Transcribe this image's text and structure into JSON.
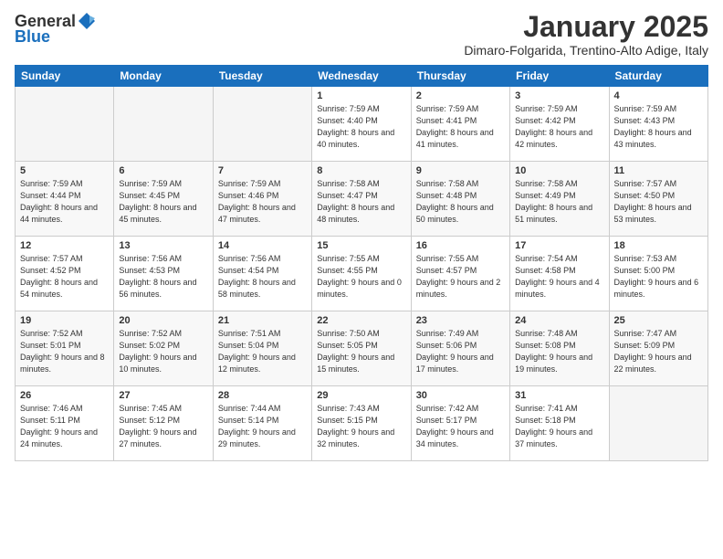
{
  "header": {
    "logo_line1": "General",
    "logo_line2": "Blue",
    "month": "January 2025",
    "location": "Dimaro-Folgarida, Trentino-Alto Adige, Italy"
  },
  "weekdays": [
    "Sunday",
    "Monday",
    "Tuesday",
    "Wednesday",
    "Thursday",
    "Friday",
    "Saturday"
  ],
  "weeks": [
    [
      {
        "day": "",
        "empty": true
      },
      {
        "day": "",
        "empty": true
      },
      {
        "day": "",
        "empty": true
      },
      {
        "day": "1",
        "sunrise": "7:59 AM",
        "sunset": "4:40 PM",
        "daylight": "8 hours and 40 minutes."
      },
      {
        "day": "2",
        "sunrise": "7:59 AM",
        "sunset": "4:41 PM",
        "daylight": "8 hours and 41 minutes."
      },
      {
        "day": "3",
        "sunrise": "7:59 AM",
        "sunset": "4:42 PM",
        "daylight": "8 hours and 42 minutes."
      },
      {
        "day": "4",
        "sunrise": "7:59 AM",
        "sunset": "4:43 PM",
        "daylight": "8 hours and 43 minutes."
      }
    ],
    [
      {
        "day": "5",
        "sunrise": "7:59 AM",
        "sunset": "4:44 PM",
        "daylight": "8 hours and 44 minutes."
      },
      {
        "day": "6",
        "sunrise": "7:59 AM",
        "sunset": "4:45 PM",
        "daylight": "8 hours and 45 minutes."
      },
      {
        "day": "7",
        "sunrise": "7:59 AM",
        "sunset": "4:46 PM",
        "daylight": "8 hours and 47 minutes."
      },
      {
        "day": "8",
        "sunrise": "7:58 AM",
        "sunset": "4:47 PM",
        "daylight": "8 hours and 48 minutes."
      },
      {
        "day": "9",
        "sunrise": "7:58 AM",
        "sunset": "4:48 PM",
        "daylight": "8 hours and 50 minutes."
      },
      {
        "day": "10",
        "sunrise": "7:58 AM",
        "sunset": "4:49 PM",
        "daylight": "8 hours and 51 minutes."
      },
      {
        "day": "11",
        "sunrise": "7:57 AM",
        "sunset": "4:50 PM",
        "daylight": "8 hours and 53 minutes."
      }
    ],
    [
      {
        "day": "12",
        "sunrise": "7:57 AM",
        "sunset": "4:52 PM",
        "daylight": "8 hours and 54 minutes."
      },
      {
        "day": "13",
        "sunrise": "7:56 AM",
        "sunset": "4:53 PM",
        "daylight": "8 hours and 56 minutes."
      },
      {
        "day": "14",
        "sunrise": "7:56 AM",
        "sunset": "4:54 PM",
        "daylight": "8 hours and 58 minutes."
      },
      {
        "day": "15",
        "sunrise": "7:55 AM",
        "sunset": "4:55 PM",
        "daylight": "9 hours and 0 minutes."
      },
      {
        "day": "16",
        "sunrise": "7:55 AM",
        "sunset": "4:57 PM",
        "daylight": "9 hours and 2 minutes."
      },
      {
        "day": "17",
        "sunrise": "7:54 AM",
        "sunset": "4:58 PM",
        "daylight": "9 hours and 4 minutes."
      },
      {
        "day": "18",
        "sunrise": "7:53 AM",
        "sunset": "5:00 PM",
        "daylight": "9 hours and 6 minutes."
      }
    ],
    [
      {
        "day": "19",
        "sunrise": "7:52 AM",
        "sunset": "5:01 PM",
        "daylight": "9 hours and 8 minutes."
      },
      {
        "day": "20",
        "sunrise": "7:52 AM",
        "sunset": "5:02 PM",
        "daylight": "9 hours and 10 minutes."
      },
      {
        "day": "21",
        "sunrise": "7:51 AM",
        "sunset": "5:04 PM",
        "daylight": "9 hours and 12 minutes."
      },
      {
        "day": "22",
        "sunrise": "7:50 AM",
        "sunset": "5:05 PM",
        "daylight": "9 hours and 15 minutes."
      },
      {
        "day": "23",
        "sunrise": "7:49 AM",
        "sunset": "5:06 PM",
        "daylight": "9 hours and 17 minutes."
      },
      {
        "day": "24",
        "sunrise": "7:48 AM",
        "sunset": "5:08 PM",
        "daylight": "9 hours and 19 minutes."
      },
      {
        "day": "25",
        "sunrise": "7:47 AM",
        "sunset": "5:09 PM",
        "daylight": "9 hours and 22 minutes."
      }
    ],
    [
      {
        "day": "26",
        "sunrise": "7:46 AM",
        "sunset": "5:11 PM",
        "daylight": "9 hours and 24 minutes."
      },
      {
        "day": "27",
        "sunrise": "7:45 AM",
        "sunset": "5:12 PM",
        "daylight": "9 hours and 27 minutes."
      },
      {
        "day": "28",
        "sunrise": "7:44 AM",
        "sunset": "5:14 PM",
        "daylight": "9 hours and 29 minutes."
      },
      {
        "day": "29",
        "sunrise": "7:43 AM",
        "sunset": "5:15 PM",
        "daylight": "9 hours and 32 minutes."
      },
      {
        "day": "30",
        "sunrise": "7:42 AM",
        "sunset": "5:17 PM",
        "daylight": "9 hours and 34 minutes."
      },
      {
        "day": "31",
        "sunrise": "7:41 AM",
        "sunset": "5:18 PM",
        "daylight": "9 hours and 37 minutes."
      },
      {
        "day": "",
        "empty": true
      }
    ]
  ]
}
